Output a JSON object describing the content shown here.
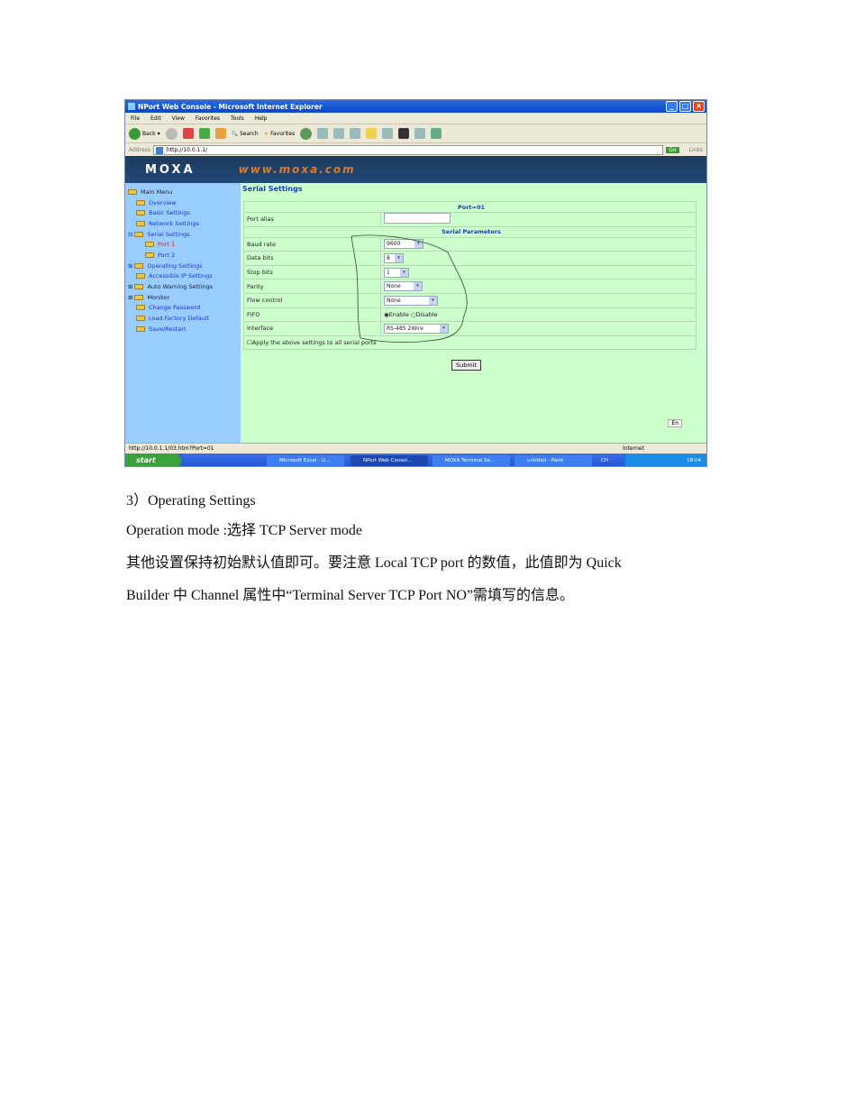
{
  "browser": {
    "title": "NPort Web Console - Microsoft Internet Explorer",
    "menu": [
      "File",
      "Edit",
      "View",
      "Favorites",
      "Tools",
      "Help"
    ],
    "back": "Back",
    "search": "Search",
    "favorites": "Favorites",
    "address_label": "Address",
    "address": "http://10.0.1.1/",
    "go": "Go",
    "links": "Links"
  },
  "banner": {
    "logo": "MOXA",
    "url": "www.moxa.com"
  },
  "sidebar": {
    "items": [
      "Main Menu",
      "Overview",
      "Basic Settings",
      "Network Settings",
      "Serial Settings",
      "Port 1",
      "Port 2",
      "Operating Settings",
      "Accessible IP Settings",
      "Auto Warning Settings",
      "Monitor",
      "Change Password",
      "Load Factory Default",
      "Save/Restart"
    ]
  },
  "page": {
    "title": "Serial Settings",
    "port_header": "Port=01",
    "port_alias_label": "Port alias",
    "port_alias_value": "",
    "serial_params_header": "Serial Parameters",
    "rows": [
      {
        "label": "Baud rate",
        "value": "9600"
      },
      {
        "label": "Data bits",
        "value": "8"
      },
      {
        "label": "Stop bits",
        "value": "1"
      },
      {
        "label": "Parity",
        "value": "None"
      },
      {
        "label": "Flow control",
        "value": "None"
      }
    ],
    "fifo_label": "FIFO",
    "fifo_enable": "Enable",
    "fifo_disable": "Disable",
    "interface_label": "Interface",
    "interface_value": "RS-485 2Wire",
    "apply_all": "Apply the above settings to all serial ports",
    "submit": "Submit",
    "ime": "En"
  },
  "status": {
    "url": "http://10.0.1.1/03.htm?Port=01",
    "zone": "Internet"
  },
  "taskbar": {
    "start": "start",
    "tasks": [
      "Microsoft Excel - U...",
      "NPort Web Consol...",
      "MOXA Terminal Se...",
      "untitled - Paint"
    ],
    "lang": "CH",
    "clock": "18:04"
  },
  "doc": {
    "heading": "3）Operating Settings",
    "line1": "Operation mode :选择 TCP Server mode",
    "line2": "其他设置保持初始默认值即可。要注意 Local TCP port 的数值，此值即为 Quick",
    "line3": "Builder 中 Channel 属性中“Terminal Server TCP Port NO”需填写的信息。"
  }
}
